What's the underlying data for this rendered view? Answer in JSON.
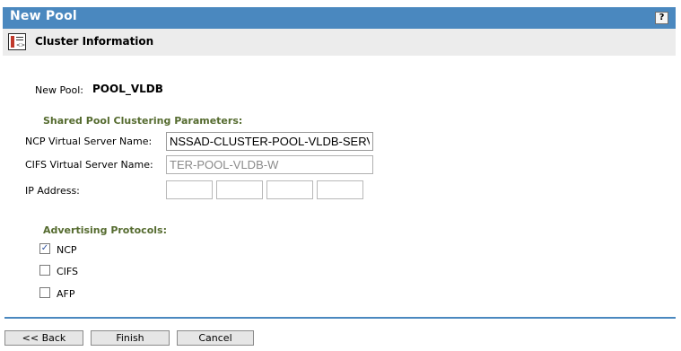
{
  "header": {
    "title": "New Pool",
    "help_label": "?"
  },
  "subheader": {
    "icon": "cluster-info-icon",
    "title": "Cluster Information"
  },
  "pool": {
    "label": "New Pool:",
    "name": "POOL_VLDB"
  },
  "clustering": {
    "section_title": "Shared Pool Clustering Parameters:",
    "ncp_label": "NCP Virtual Server Name:",
    "ncp_value": "NSSAD-CLUSTER-POOL-VLDB-SERVER",
    "cifs_label": "CIFS Virtual Server Name:",
    "cifs_value": "TER-POOL-VLDB-W",
    "ip_label": "IP Address:"
  },
  "protocols": {
    "section_title": "Advertising Protocols:",
    "items": [
      {
        "label": "NCP",
        "checked": true
      },
      {
        "label": "CIFS",
        "checked": false
      },
      {
        "label": "AFP",
        "checked": false
      }
    ]
  },
  "buttons": {
    "back": "<< Back",
    "finish": "Finish",
    "cancel": "Cancel"
  },
  "colors": {
    "header": "#4a88bf",
    "section": "#556b2f",
    "subheader": "#ececec"
  }
}
